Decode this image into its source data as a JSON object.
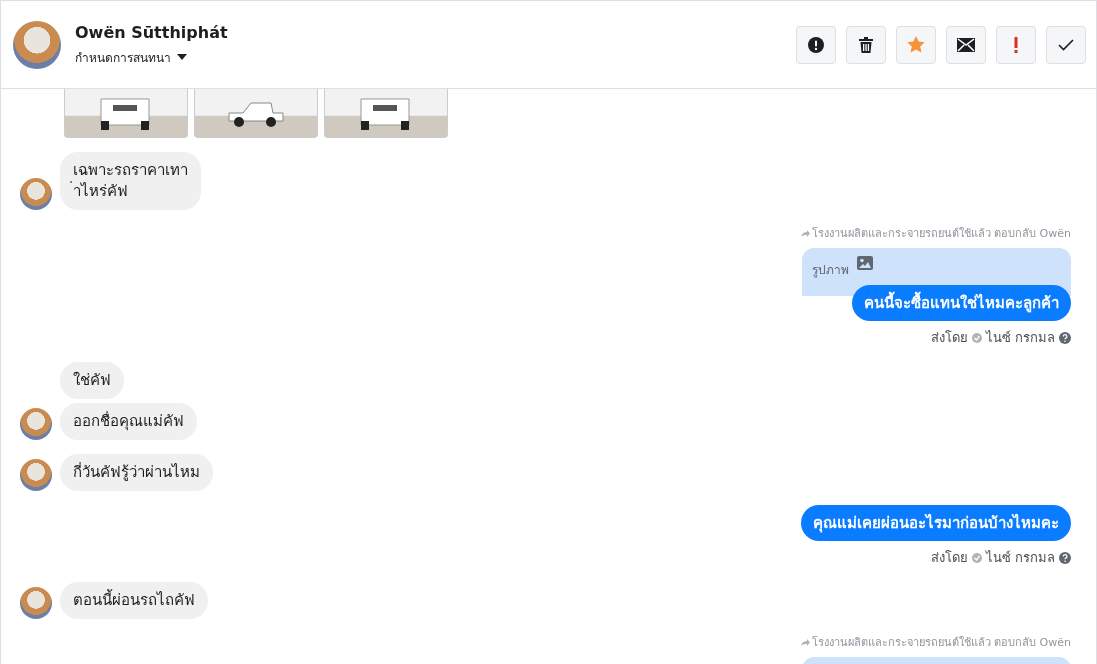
{
  "header": {
    "name": "Owën Sūtthiphát",
    "subtitle": "กำหนดการสนทนา",
    "actions": [
      {
        "kind": "alert"
      },
      {
        "kind": "trash"
      },
      {
        "kind": "star"
      },
      {
        "kind": "mail"
      },
      {
        "kind": "exclaim"
      },
      {
        "kind": "check"
      }
    ]
  },
  "messages": [
    {
      "kind": "photos",
      "photos": [
        {
          "kind": "truck-front"
        },
        {
          "kind": "truck-side"
        },
        {
          "kind": "truck-front"
        }
      ]
    },
    {
      "kind": "incoming",
      "text": "เฉพาะรถราคาเทา\n่าไหร่คัฟ",
      "avatar": true
    },
    {
      "kind": "reply_label",
      "text": "โรงงานผลิตและกระจายรถยนต์ใช้แล้ว ตอบกลับ Owën"
    },
    {
      "kind": "reply",
      "quote": "รูปภาพ",
      "text": "คนนี้จะซื้อแทนใช่ไหมคะลูกค้า"
    },
    {
      "kind": "sent_by",
      "prefix": "ส่งโดย",
      "sender": "ไนซ์ กรกมล"
    },
    {
      "kind": "incoming",
      "text": "ใช่คัฟ",
      "avatar": false
    },
    {
      "kind": "incoming",
      "text": "ออกชื่อคุณแม่คัฟ",
      "avatar": true
    },
    {
      "kind": "incoming",
      "text": "กี่วันคัฟรู้ว่าผ่านไหม",
      "avatar": true
    },
    {
      "kind": "outgoing",
      "text": "คุณแม่เคยผ่อนอะไรมาก่อนบ้างไหมคะ"
    },
    {
      "kind": "sent_by",
      "prefix": "ส่งโดย",
      "sender": "ไนซ์ กรกมล"
    },
    {
      "kind": "incoming",
      "text": "ตอนนี้ผ่อนรถไถคัฟ",
      "avatar": true
    },
    {
      "kind": "reply_label",
      "text": "โรงงานผลิตและกระจายรถยนต์ใช้แล้ว ตอบกลับ Owën"
    },
    {
      "kind": "reply_partial"
    }
  ]
}
